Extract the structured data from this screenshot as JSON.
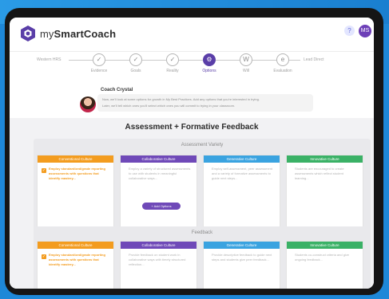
{
  "app": {
    "brand_prefix": "my",
    "brand_name": "SmartCoach",
    "help_label": "?",
    "user_initials": "MS"
  },
  "stepper": {
    "start_label": "Western HRS",
    "end_label": "Lead Direct",
    "steps": [
      {
        "icon": "check-icon",
        "glyph": "✓",
        "label": "Evidence"
      },
      {
        "icon": "check-icon",
        "glyph": "✓",
        "label": "Goals"
      },
      {
        "icon": "check-icon",
        "glyph": "✓",
        "label": "Reality"
      },
      {
        "icon": "gear-icon",
        "glyph": "⚙",
        "label": "Options"
      },
      {
        "icon": "w-icon",
        "glyph": "W",
        "label": "Will"
      },
      {
        "icon": "e-icon",
        "glyph": "e",
        "label": "Evaluation"
      }
    ]
  },
  "coach": {
    "name": "Coach Crystal",
    "message_line1": "Now, we'll look at some options for growth in My Best Practices. Add any options that you're interested in trying.",
    "message_line2": "Later, we'll tell which ones you'll select which ones you will commit to trying in your classroom."
  },
  "main": {
    "title": "Assessment + Formative Feedback",
    "sections": [
      {
        "title": "Assessment Variety",
        "columns": [
          {
            "header": "Conventional Culture",
            "selected": true,
            "text": "Employ standardized/grade reporting assessments with questions that identify mastery..."
          },
          {
            "header": "Collaborative Culture",
            "selected": false,
            "text": "Employ a variety of structured assessments to use with students in meaningful collaborative ways..."
          },
          {
            "header": "Generative Culture",
            "selected": false,
            "text": "Employ self-assessment, peer assessment and a variety of formative assessments to guide next steps..."
          },
          {
            "header": "Innovative Culture",
            "selected": false,
            "text": "Students are encouraged to create assessments which reflect student learning..."
          }
        ],
        "add_button": "+ Add Options"
      },
      {
        "title": "Feedback",
        "columns": [
          {
            "header": "Conventional Culture",
            "selected": true,
            "text": "Employ standardized/grade reporting assessments with questions that identify mastery..."
          },
          {
            "header": "Collaborative Culture",
            "selected": false,
            "text": "Provide feedback on student work in collaborative ways with timely structured reflection..."
          },
          {
            "header": "Generative Culture",
            "selected": false,
            "text": "Provide descriptive feedback to guide next steps and students give peer feedback..."
          },
          {
            "header": "Innovative Culture",
            "selected": false,
            "text": "Students co-construct criteria and give ongoing feedback..."
          }
        ]
      }
    ]
  },
  "colors": {
    "accent": "#5a3ea8",
    "conventional": "#f39c1f",
    "collaborative": "#6f49b8",
    "generative": "#3aa3e0",
    "innovative": "#3ab166",
    "background": "#1e88d8"
  }
}
